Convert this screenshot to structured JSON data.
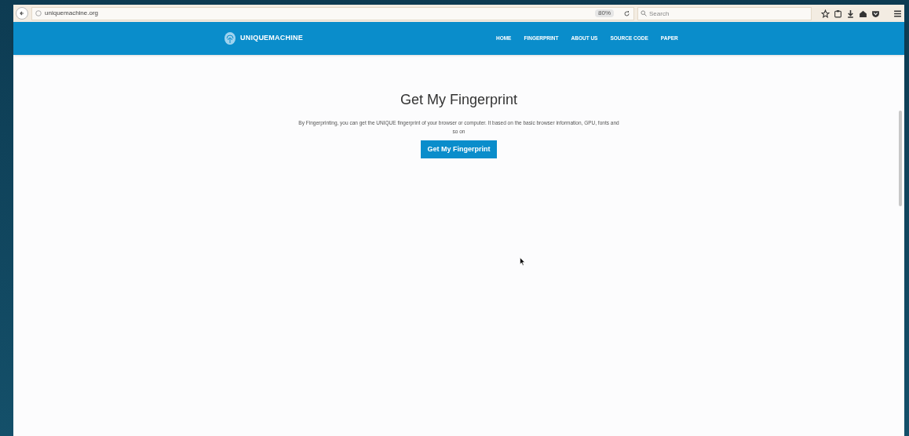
{
  "browser": {
    "url": "uniquemachine.org",
    "zoom": "80%",
    "search": {
      "placeholder": "Search"
    }
  },
  "site": {
    "logo": "UNIQUEMACHINE",
    "nav": [
      {
        "label": "HOME"
      },
      {
        "label": "FINGERPRINT"
      },
      {
        "label": "ABOUT US"
      },
      {
        "label": "SOURCE CODE"
      },
      {
        "label": "PAPER"
      }
    ]
  },
  "main": {
    "title": "Get My Fingerprint",
    "description": "By Fingerprinting, you can get the UNIQUE fingerprint of your browser or computer. It based on the basic browser information, GPU, fonts and so on",
    "button": "Get My Fingerprint"
  }
}
